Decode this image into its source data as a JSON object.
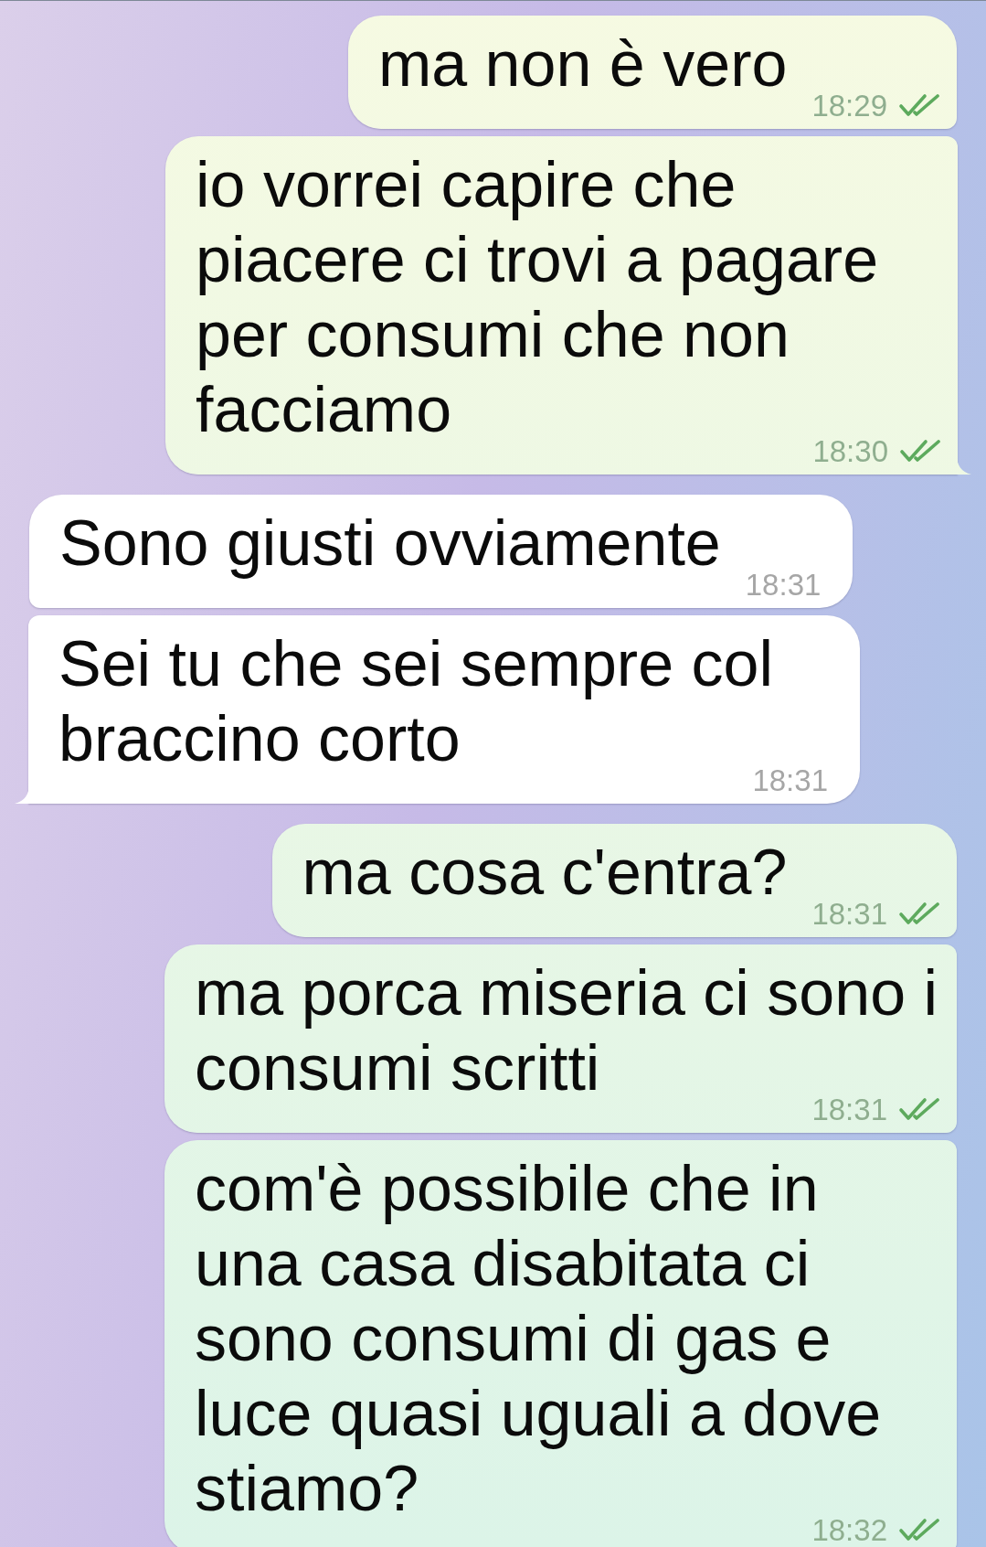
{
  "messages": [
    {
      "kind": "outgoing",
      "text": "ma non è vero",
      "time": "18:29",
      "read": true
    },
    {
      "kind": "outgoing",
      "text": "io vorrei capire che piacere ci trovi a pagare per consumi che non facciamo",
      "time": "18:30",
      "read": true
    },
    {
      "kind": "incoming",
      "text": "Sono giusti ovviamente",
      "time": "18:31"
    },
    {
      "kind": "incoming",
      "text": "Sei tu che sei sempre col braccino corto",
      "time": "18:31"
    },
    {
      "kind": "outgoing",
      "text": "ma cosa c'entra?",
      "time": "18:31",
      "read": true
    },
    {
      "kind": "outgoing",
      "text": "ma porca miseria ci sono i consumi scritti",
      "time": "18:31",
      "read": true
    },
    {
      "kind": "outgoing",
      "text": "com'è possibile che in una casa disabitata ci sono consumi di gas e luce quasi uguali a dove stiamo?",
      "time": "18:32",
      "read": true
    }
  ]
}
